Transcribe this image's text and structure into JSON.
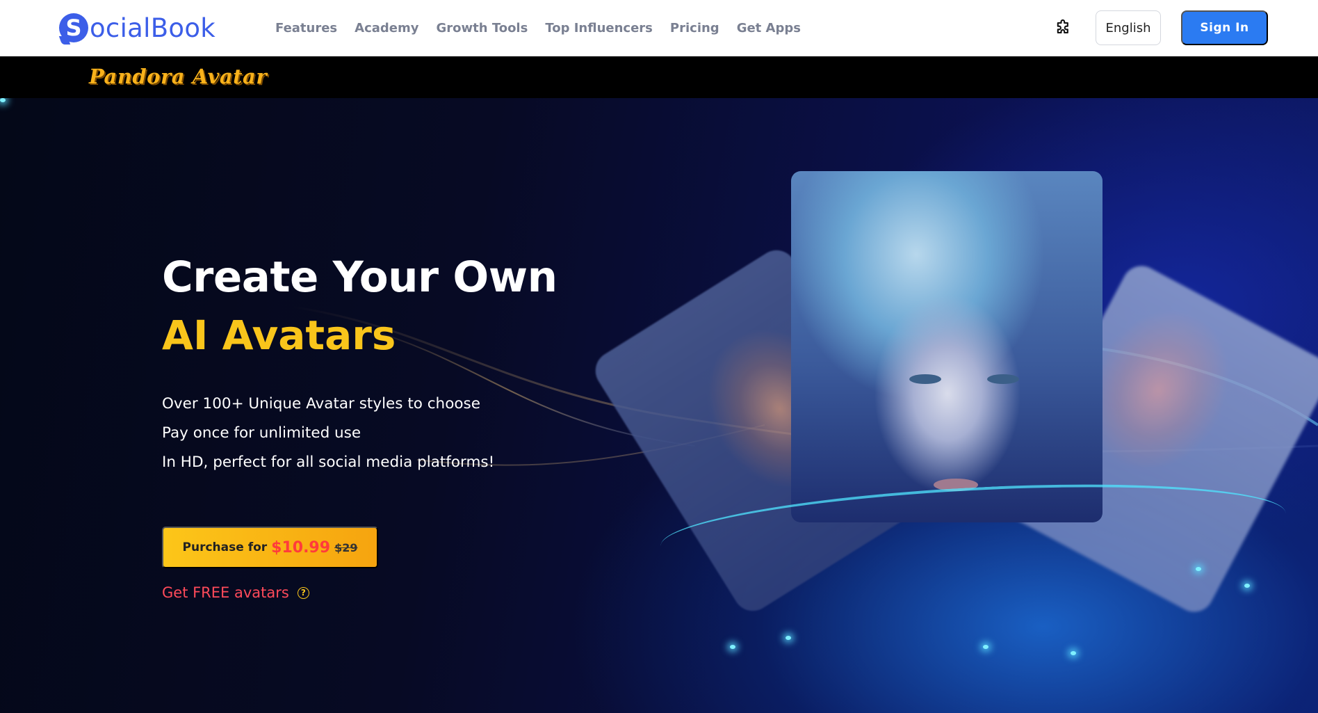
{
  "nav": {
    "logo_letter": "S",
    "logo_text": "ocialBook",
    "links": [
      "Features",
      "Academy",
      "Growth Tools",
      "Top Influencers",
      "Pricing",
      "Get Apps"
    ],
    "language": "English",
    "sign_in": "Sign In"
  },
  "banner": {
    "brand": "Pandora Avatar"
  },
  "hero": {
    "headline_line1": "Create Your Own",
    "headline_line2": "AI Avatars",
    "bullets": [
      "Over 100+ Unique Avatar styles to choose",
      "Pay once for unlimited use",
      "In HD, perfect for all social media platforms!"
    ],
    "purchase": {
      "label": "Purchase for",
      "price": "$10.99",
      "old_price": "$29"
    },
    "free_link": "Get FREE avatars",
    "help_glyph": "?"
  },
  "colors": {
    "brand_blue": "#3c5ee8",
    "sign_in_blue": "#2b7bf2",
    "accent_yellow": "#f9c51b",
    "price_red": "#ff3b3b",
    "free_link_red": "#ff4a5a"
  },
  "icons": [
    "extension-puzzle-icon",
    "help-circle-icon"
  ]
}
